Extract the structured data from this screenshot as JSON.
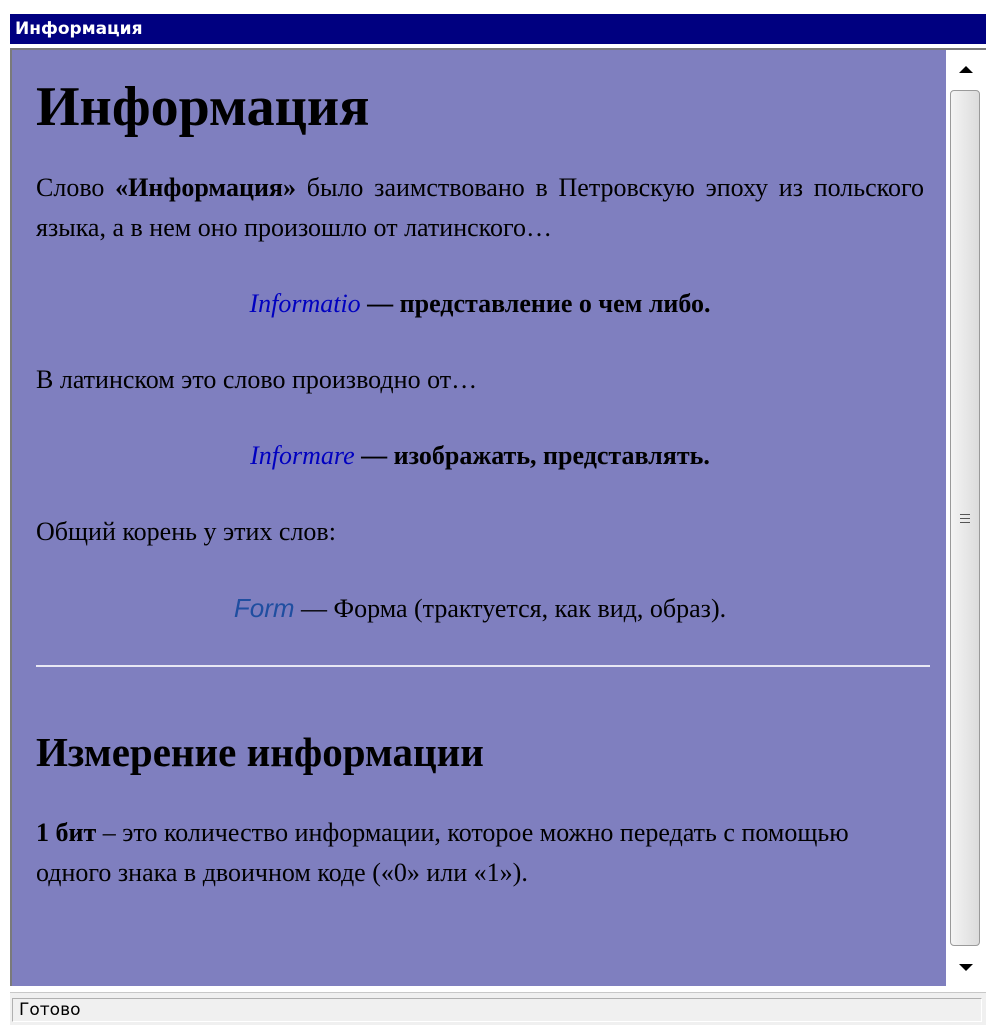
{
  "window": {
    "title": "Информация"
  },
  "article": {
    "heading": "Информация",
    "intro": {
      "pre": "Слово ",
      "bold": "«Информация»",
      "post": " было заимствовано в Петровскую эпоху из польского языка, а в нем оно произошло от латинского…"
    },
    "def1": {
      "term": "Informatio",
      "dash": " — ",
      "meaning": "представление о чем либо."
    },
    "para2": "В латинском это слово производно от…",
    "def2": {
      "term": "Informare",
      "dash": " — ",
      "meaning": "изображать, представлять."
    },
    "para3": "Общий корень у этих слов:",
    "def3": {
      "term": "Form",
      "dash": " — ",
      "meaning": "Форма (трактуется, как вид, образ)."
    },
    "section2": {
      "heading": "Измерение информации",
      "bold": "1 бит",
      "text": " – это количество информации, которое можно передать с помощью одного знака в двоичном коде («0» или «1»)."
    }
  },
  "statusbar": {
    "text": "Готово"
  },
  "colors": {
    "titlebar": "#000080",
    "content_bg": "#7f7fbf",
    "term_link": "#0000c0"
  },
  "icons": {
    "scroll_up": "triangle-up",
    "scroll_down": "triangle-down",
    "thumb_grip": "grip-lines"
  }
}
